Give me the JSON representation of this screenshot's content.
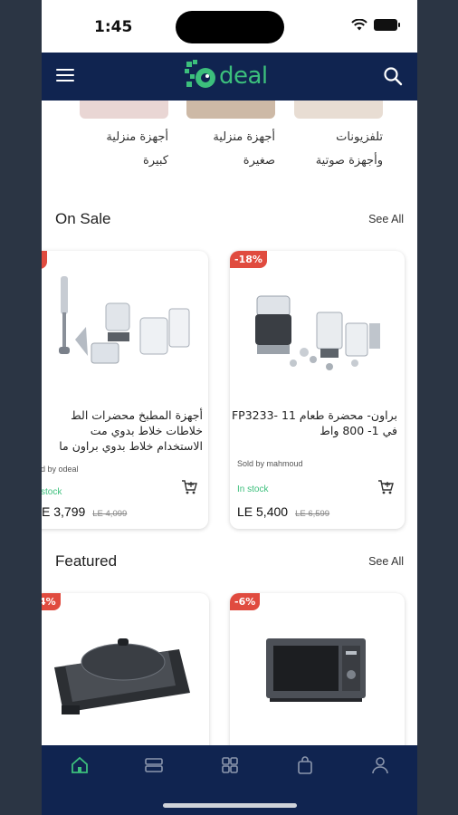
{
  "status_bar": {
    "time": "1:45"
  },
  "header": {
    "logo_text": "deal"
  },
  "categories": [
    {
      "label_1": "أجهزة منزلية",
      "label_2": "كبيرة"
    },
    {
      "label_1": "أجهزة منزلية",
      "label_2": "صغيرة"
    },
    {
      "label_1": "تلفزيونات",
      "label_2": "وأجهزة صوتية"
    }
  ],
  "on_sale": {
    "title": "On Sale",
    "see_all": "See All",
    "products": [
      {
        "badge": "-18%",
        "title_1": "براون- محضرة طعام FP3233- 11",
        "title_2": "في 1- 800 واط",
        "seller": "Sold by mahmoud",
        "stock": "In stock",
        "price": "LE 5,400",
        "old_price": "LE 6,599"
      },
      {
        "badge": "",
        "title_1": "أجهزة المطبخ محضرات الط",
        "title_2": "خلاطات خلاط بدوي مت",
        "title_3": "الاستخدام خلاط بدوي براون ما",
        "seller": "d by odeal",
        "stock": "stock",
        "price": "E 3,799",
        "old_price": "LE 4,099"
      }
    ]
  },
  "featured": {
    "title": "Featured",
    "see_all": "See All",
    "products": [
      {
        "badge": "-6%"
      },
      {
        "badge": "4%"
      }
    ]
  },
  "colors": {
    "nav": "#102450",
    "accent": "#3cbf7c",
    "badge": "#e04b3f"
  },
  "tabbar": {
    "items": [
      "home-icon",
      "categories-icon",
      "grid-icon",
      "bag-icon",
      "profile-icon"
    ]
  }
}
